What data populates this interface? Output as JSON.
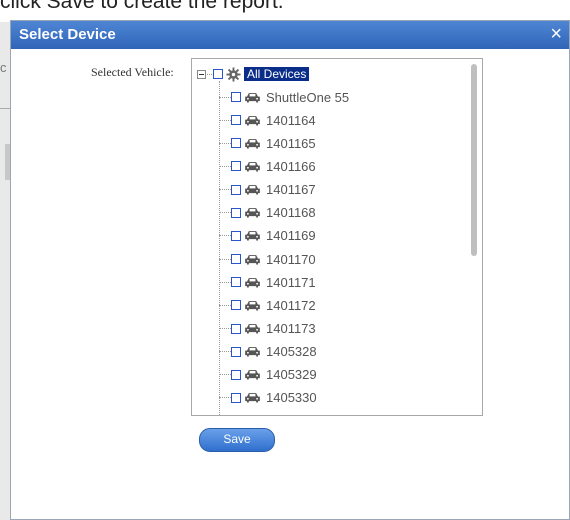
{
  "background": {
    "instruction": "click Save to create the report.",
    "fragments": [
      "c"
    ]
  },
  "dialog": {
    "title": "Select Device",
    "close_glyph": "×",
    "field_label": "Selected Vehicle:",
    "save_label": "Save"
  },
  "tree": {
    "root": {
      "label": "All Devices",
      "icon": "gear-icon"
    },
    "children": [
      {
        "label": "ShuttleOne 55",
        "icon": "car-icon"
      },
      {
        "label": "1401164",
        "icon": "car-icon"
      },
      {
        "label": "1401165",
        "icon": "car-icon"
      },
      {
        "label": "1401166",
        "icon": "car-icon"
      },
      {
        "label": "1401167",
        "icon": "car-icon"
      },
      {
        "label": "1401168",
        "icon": "car-icon"
      },
      {
        "label": "1401169",
        "icon": "car-icon"
      },
      {
        "label": "1401170",
        "icon": "car-icon"
      },
      {
        "label": "1401171",
        "icon": "car-icon"
      },
      {
        "label": "1401172",
        "icon": "car-icon"
      },
      {
        "label": "1401173",
        "icon": "car-icon"
      },
      {
        "label": "1405328",
        "icon": "car-icon"
      },
      {
        "label": "1405329",
        "icon": "car-icon"
      },
      {
        "label": "1405330",
        "icon": "car-icon"
      }
    ]
  },
  "colors": {
    "titlebar": "#3a73c6",
    "selection": "#0a2d8a",
    "button": "#2f6fcd"
  }
}
